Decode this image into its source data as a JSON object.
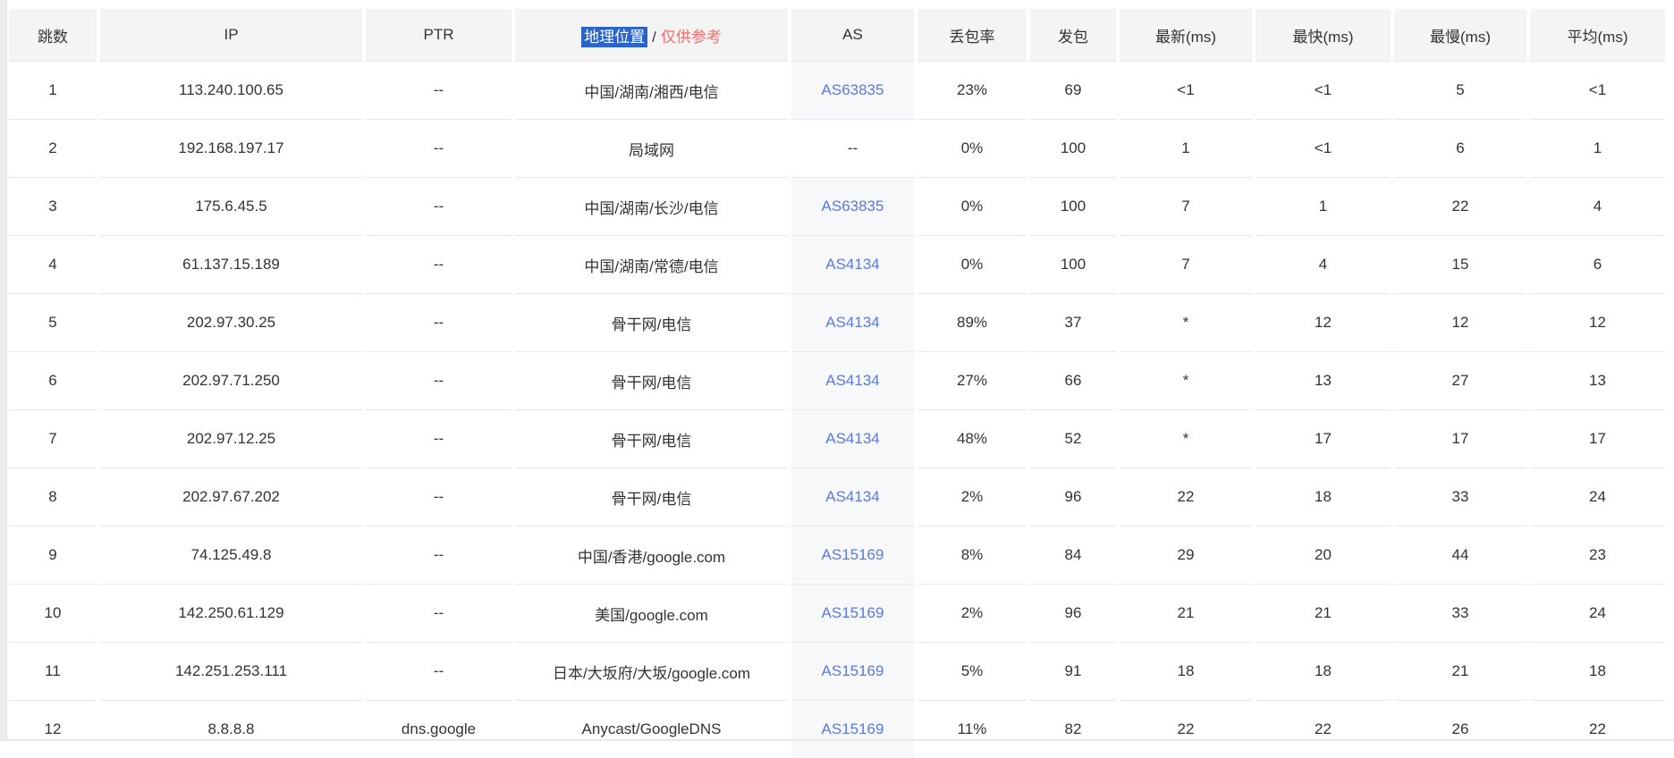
{
  "colors": {
    "selection_bg": "#2b63cc",
    "note_red": "#f56c6c",
    "link_blue": "#5b79e0",
    "header_bg": "#f4f4f5",
    "as_cell_bg": "#f7f8fa",
    "row_border": "#e8e8e8",
    "text": "#333333"
  },
  "table": {
    "headers": [
      "跳数",
      "IP",
      "PTR",
      "地理位置",
      "AS",
      "丢包率",
      "发包",
      "最新(ms)",
      "最快(ms)",
      "最慢(ms)",
      "平均(ms)"
    ],
    "location_header": {
      "highlighted": "地理位置",
      "separator": "/",
      "note": "仅供参考"
    },
    "rows": [
      {
        "hop": "1",
        "ip": "113.240.100.65",
        "ptr": "--",
        "location": "中国/湖南/湘西/电信",
        "as": "AS63835",
        "loss": "23%",
        "sent": "69",
        "latest": "<1",
        "fastest": "<1",
        "slowest": "5",
        "avg": "<1"
      },
      {
        "hop": "2",
        "ip": "192.168.197.17",
        "ptr": "--",
        "location": "局域网",
        "as": "--",
        "loss": "0%",
        "sent": "100",
        "latest": "1",
        "fastest": "<1",
        "slowest": "6",
        "avg": "1"
      },
      {
        "hop": "3",
        "ip": "175.6.45.5",
        "ptr": "--",
        "location": "中国/湖南/长沙/电信",
        "as": "AS63835",
        "loss": "0%",
        "sent": "100",
        "latest": "7",
        "fastest": "1",
        "slowest": "22",
        "avg": "4"
      },
      {
        "hop": "4",
        "ip": "61.137.15.189",
        "ptr": "--",
        "location": "中国/湖南/常德/电信",
        "as": "AS4134",
        "loss": "0%",
        "sent": "100",
        "latest": "7",
        "fastest": "4",
        "slowest": "15",
        "avg": "6"
      },
      {
        "hop": "5",
        "ip": "202.97.30.25",
        "ptr": "--",
        "location": "骨干网/电信",
        "as": "AS4134",
        "loss": "89%",
        "sent": "37",
        "latest": "*",
        "fastest": "12",
        "slowest": "12",
        "avg": "12"
      },
      {
        "hop": "6",
        "ip": "202.97.71.250",
        "ptr": "--",
        "location": "骨干网/电信",
        "as": "AS4134",
        "loss": "27%",
        "sent": "66",
        "latest": "*",
        "fastest": "13",
        "slowest": "27",
        "avg": "13"
      },
      {
        "hop": "7",
        "ip": "202.97.12.25",
        "ptr": "--",
        "location": "骨干网/电信",
        "as": "AS4134",
        "loss": "48%",
        "sent": "52",
        "latest": "*",
        "fastest": "17",
        "slowest": "17",
        "avg": "17"
      },
      {
        "hop": "8",
        "ip": "202.97.67.202",
        "ptr": "--",
        "location": "骨干网/电信",
        "as": "AS4134",
        "loss": "2%",
        "sent": "96",
        "latest": "22",
        "fastest": "18",
        "slowest": "33",
        "avg": "24"
      },
      {
        "hop": "9",
        "ip": "74.125.49.8",
        "ptr": "--",
        "location": "中国/香港/google.com",
        "as": "AS15169",
        "loss": "8%",
        "sent": "84",
        "latest": "29",
        "fastest": "20",
        "slowest": "44",
        "avg": "23"
      },
      {
        "hop": "10",
        "ip": "142.250.61.129",
        "ptr": "--",
        "location": "美国/google.com",
        "as": "AS15169",
        "loss": "2%",
        "sent": "96",
        "latest": "21",
        "fastest": "21",
        "slowest": "33",
        "avg": "24"
      },
      {
        "hop": "11",
        "ip": "142.251.253.111",
        "ptr": "--",
        "location": "日本/大坂府/大坂/google.com",
        "as": "AS15169",
        "loss": "5%",
        "sent": "91",
        "latest": "18",
        "fastest": "18",
        "slowest": "21",
        "avg": "18"
      },
      {
        "hop": "12",
        "ip": "8.8.8.8",
        "ptr": "dns.google",
        "location": "Anycast/GoogleDNS",
        "as": "AS15169",
        "loss": "11%",
        "sent": "82",
        "latest": "22",
        "fastest": "22",
        "slowest": "26",
        "avg": "22"
      }
    ]
  }
}
